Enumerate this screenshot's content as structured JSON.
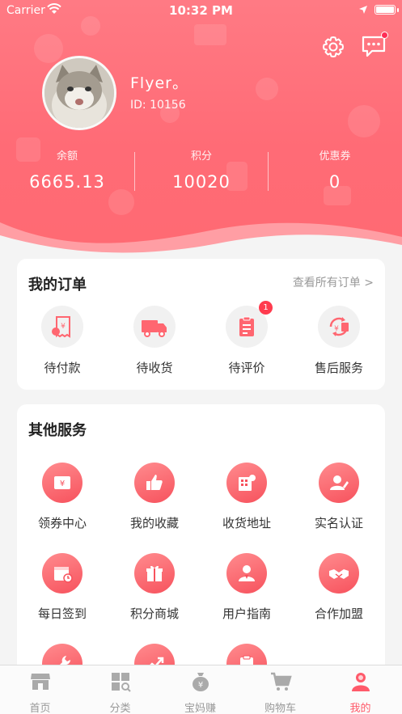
{
  "status_bar": {
    "carrier": "Carrier",
    "time": "10:32 PM"
  },
  "profile": {
    "name": "Flyer。",
    "id_text": "ID: 10156"
  },
  "stats": [
    {
      "label": "余额",
      "value": "6665.13"
    },
    {
      "label": "积分",
      "value": "10020"
    },
    {
      "label": "优惠券",
      "value": "0"
    }
  ],
  "orders": {
    "title": "我的订单",
    "view_all": "查看所有订单 >",
    "items": [
      {
        "label": "待付款",
        "icon": "receipt-icon"
      },
      {
        "label": "待收货",
        "icon": "truck-icon"
      },
      {
        "label": "待评价",
        "icon": "clipboard-icon",
        "badge": "1"
      },
      {
        "label": "售后服务",
        "icon": "refund-icon"
      }
    ]
  },
  "services": {
    "title": "其他服务",
    "items": [
      {
        "label": "领券中心",
        "icon": "coupon-icon"
      },
      {
        "label": "我的收藏",
        "icon": "thumbs-up-icon"
      },
      {
        "label": "收货地址",
        "icon": "address-icon"
      },
      {
        "label": "实名认证",
        "icon": "id-verify-icon"
      },
      {
        "label": "每日签到",
        "icon": "calendar-icon"
      },
      {
        "label": "积分商城",
        "icon": "gift-icon"
      },
      {
        "label": "用户指南",
        "icon": "guide-icon"
      },
      {
        "label": "合作加盟",
        "icon": "handshake-icon"
      },
      {
        "label": "",
        "icon": "wrench-icon"
      },
      {
        "label": "",
        "icon": "trend-icon"
      },
      {
        "label": "",
        "icon": "clipboard-icon"
      }
    ]
  },
  "tabbar": {
    "items": [
      {
        "label": "首页",
        "icon": "shop-icon"
      },
      {
        "label": "分类",
        "icon": "category-icon"
      },
      {
        "label": "宝妈赚",
        "icon": "money-bag-icon"
      },
      {
        "label": "购物车",
        "icon": "cart-icon"
      },
      {
        "label": "我的",
        "icon": "user-icon",
        "active": true
      }
    ]
  },
  "colors": {
    "accent": "#ff5a6a",
    "header": "#ff6b76"
  }
}
